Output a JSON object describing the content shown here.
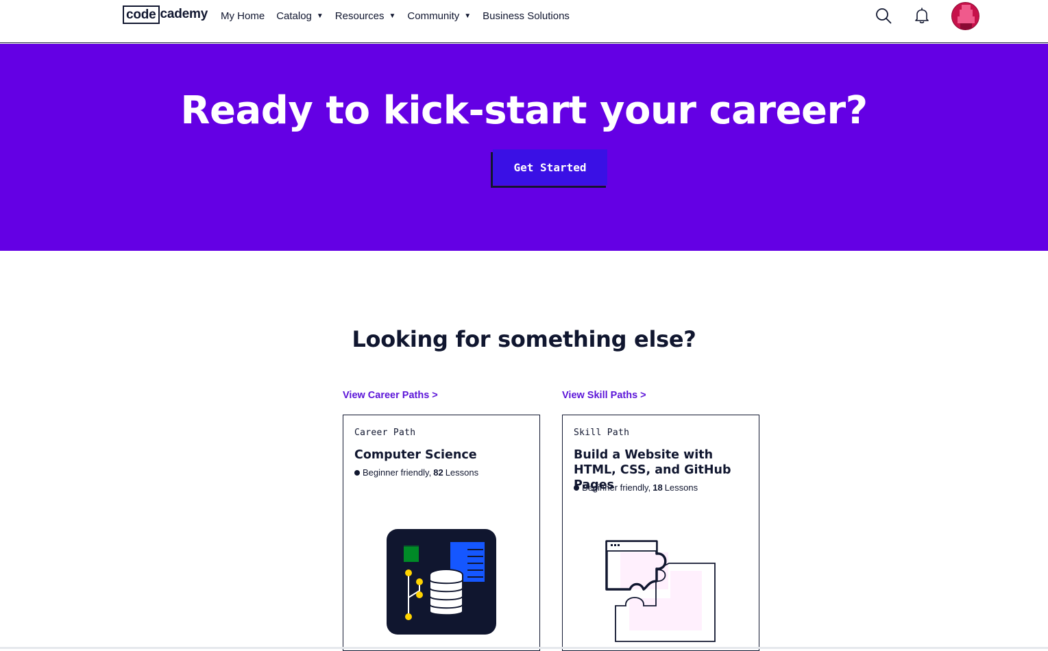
{
  "header": {
    "logo_part1": "code",
    "logo_part2": "cademy",
    "nav": [
      {
        "label": "My Home",
        "has_dropdown": false
      },
      {
        "label": "Catalog",
        "has_dropdown": true
      },
      {
        "label": "Resources",
        "has_dropdown": true
      },
      {
        "label": "Community",
        "has_dropdown": true
      },
      {
        "label": "Business Solutions",
        "has_dropdown": false
      }
    ],
    "icons": [
      "search-icon",
      "bell-icon",
      "avatar"
    ]
  },
  "hero": {
    "title": "Ready to kick-start your career?",
    "cta_label": "Get Started",
    "background": "#6400e4",
    "button_color": "#3a10e5"
  },
  "section": {
    "title": "Looking for something else?"
  },
  "columns": [
    {
      "link_label": "View Career Paths >",
      "card": {
        "type": "Career Path",
        "title": "Computer Science",
        "meta_prefix": "Beginner friendly,",
        "lesson_count": "82",
        "meta_suffix": "Lessons",
        "illustration": "database-icon"
      }
    },
    {
      "link_label": "View Skill Paths >",
      "card": {
        "type": "Skill Path",
        "title": "Build a Website with HTML, CSS, and GitHub Pages",
        "meta_prefix": "Beginner friendly,",
        "lesson_count": "18",
        "meta_suffix": "Lessons",
        "illustration": "puzzle-icon"
      }
    }
  ],
  "colors": {
    "text": "#10162f",
    "link": "#5b14d8",
    "accent_yellow": "#ffd300",
    "accent_green": "#008a27",
    "accent_blue": "#1557ff",
    "puzzle_fill": "#fff0fd"
  }
}
